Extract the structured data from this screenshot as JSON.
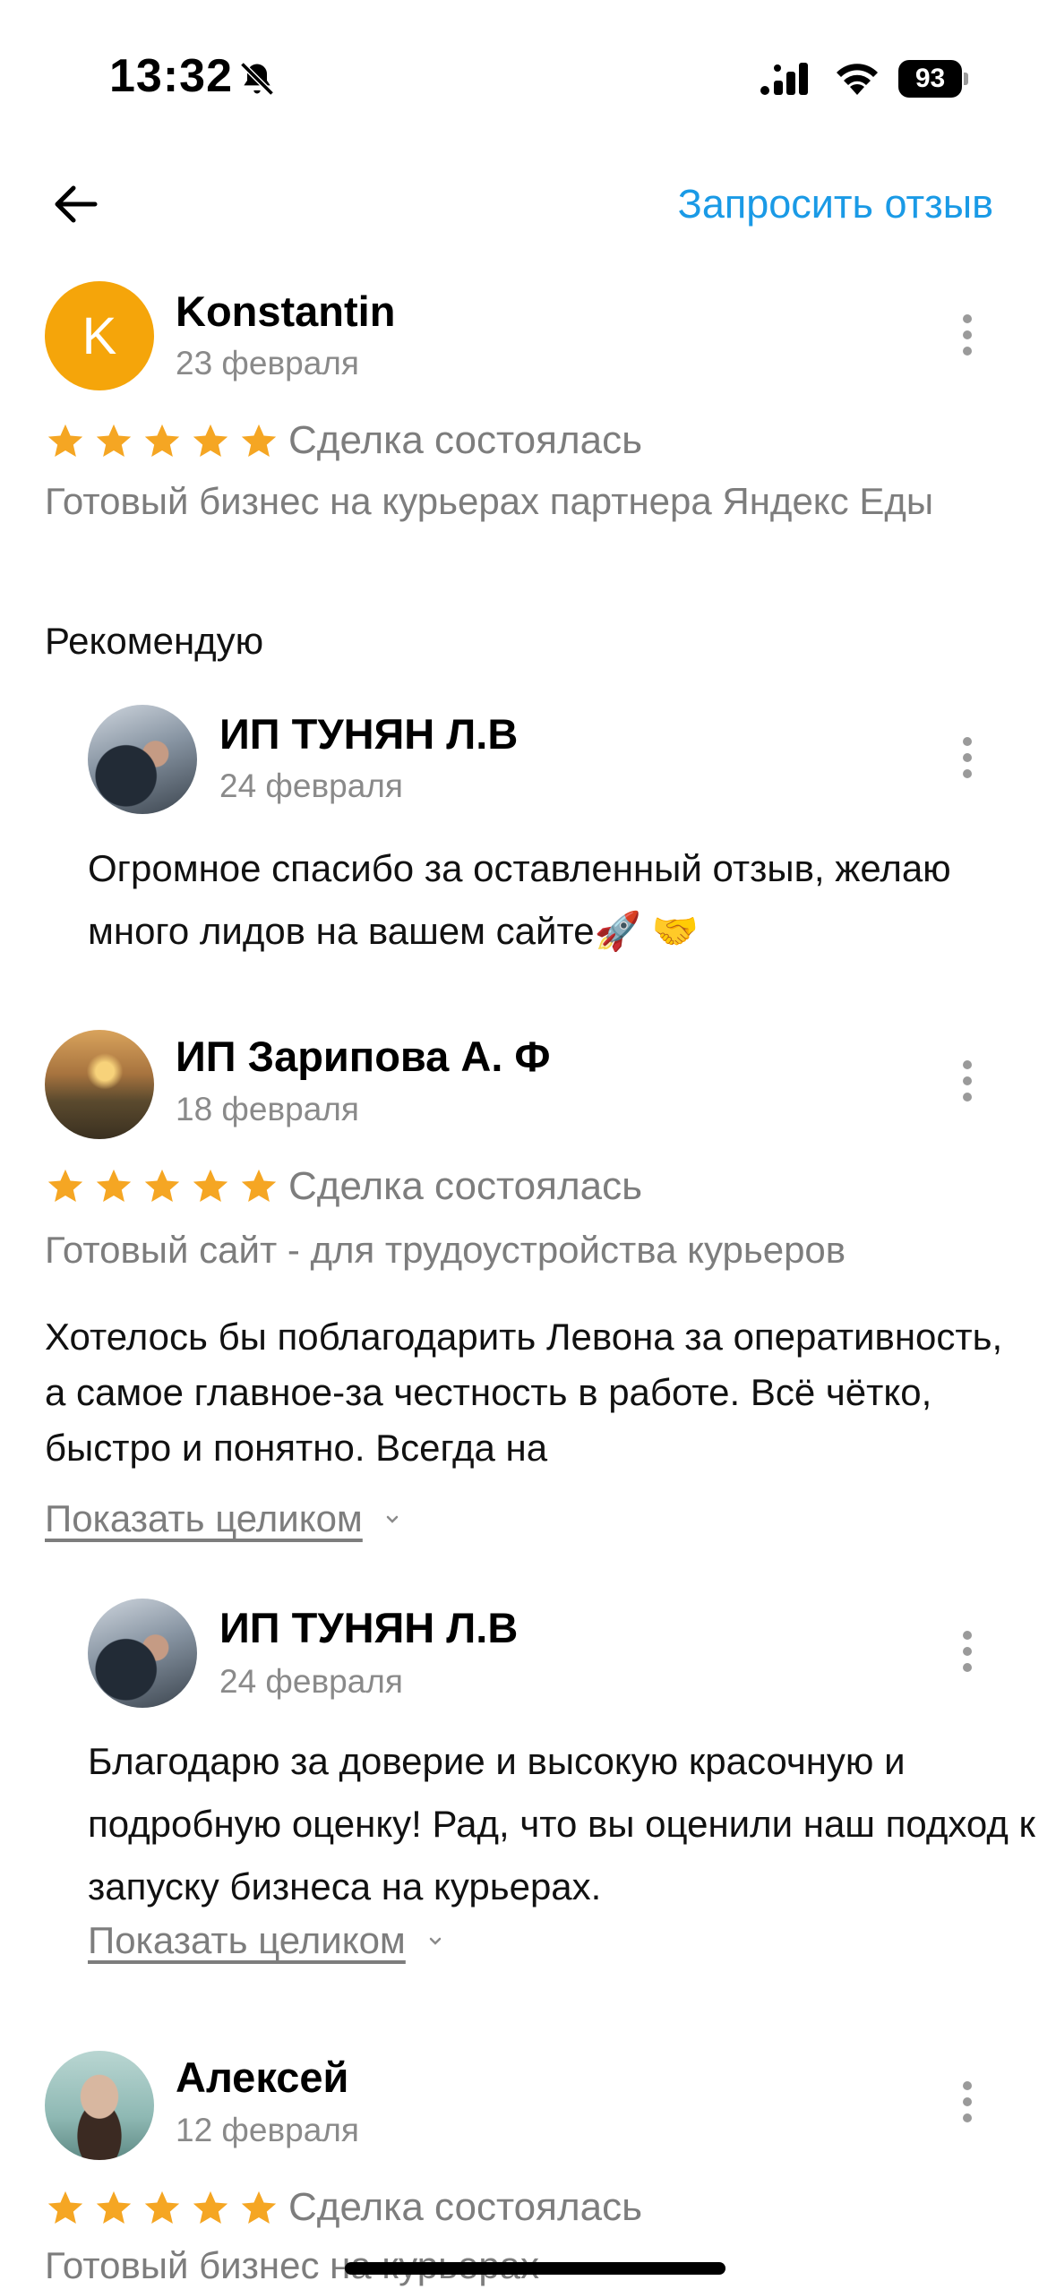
{
  "status_bar": {
    "time": "13:32",
    "battery": "93"
  },
  "header": {
    "request_review_label": "Запросить отзыв"
  },
  "reviews": [
    {
      "author": "Konstantin",
      "avatar_letter": "K",
      "date": "23 февраля",
      "rating": 5,
      "deal_status": "Сделка состоялась",
      "ad_title": "Готовый бизнес на курьерах партнера Яндекс Еды",
      "text": "Рекомендую",
      "reply": {
        "author": "ИП ТУНЯН Л.В",
        "date": "24 февраля",
        "text": "Огромное спасибо за оставленный отзыв, желаю много лидов на вашем сайте🚀 🤝"
      }
    },
    {
      "author": "ИП Зарипова А. Ф",
      "date": "18 февраля",
      "rating": 5,
      "deal_status": "Сделка состоялась",
      "ad_title": "Готовый сайт - для трудоустройства курьеров",
      "text": "Хотелось бы поблагодарить Левона за оперативность, а самое главное-за честность в работе. Всё чётко, быстро и понятно. Всегда на",
      "show_more_label": "Показать целиком",
      "reply": {
        "author": "ИП ТУНЯН Л.В",
        "date": "24 февраля",
        "text": "Благодарю за доверие и высокую красочную и подробную оценку! Рад, что вы оценили наш подход к запуску бизнеса на курьерах.",
        "show_more_label": "Показать целиком"
      }
    },
    {
      "author": "Алексей",
      "date": "12 февраля",
      "rating": 5,
      "deal_status": "Сделка состоялась",
      "ad_title": "Готовый бизнес на курьерах"
    }
  ],
  "colors": {
    "accent": "#1a9ae6",
    "star": "#f5a623",
    "avatar_bg": "#f5a50a",
    "secondary_text": "#7d7d7d"
  }
}
